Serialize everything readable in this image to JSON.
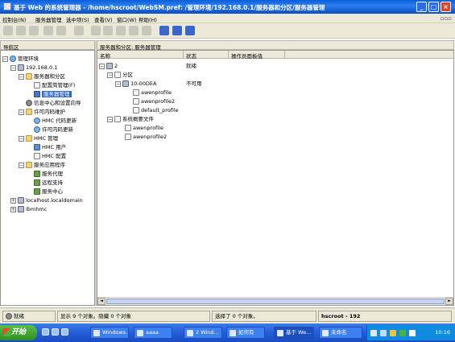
{
  "window": {
    "title": "基于 Web 的系统管理器 - /home/hscroot/WebSM.pref: /管理环境/192.168.0.1/服务器和分区/服务器管理",
    "min": "_",
    "max": "□",
    "close": "×"
  },
  "menubar": {
    "items": [
      "控制台(N)",
      "服务器管理",
      "选中项(S)",
      "查看(V)",
      "窗口(W)",
      "帮助(H)"
    ],
    "right": "▫▫▫"
  },
  "nav": {
    "header": "导航区",
    "tree": [
      {
        "label": "管理环境",
        "icon": "globe-icon"
      },
      {
        "label": "192.168.0.1",
        "icon": "server-icon"
      },
      {
        "label": "服务器和分区",
        "icon": "folder-icon"
      },
      {
        "label": "配置简管理(F)",
        "icon": "page-icon"
      },
      {
        "label": "服务器管理",
        "icon": "page-icon"
      },
      {
        "label": "信息中心和设置向导",
        "icon": "gear-icon"
      },
      {
        "label": "许可内码维护",
        "icon": "folder-icon"
      },
      {
        "label": "HMC 代码更新",
        "icon": "globe-icon"
      },
      {
        "label": "许可内码更新",
        "icon": "globe-icon"
      },
      {
        "label": "HMC 管理",
        "icon": "folder-icon"
      },
      {
        "label": "HMC 用户",
        "icon": "user-icon"
      },
      {
        "label": "HMC 配置",
        "icon": "page-icon"
      },
      {
        "label": "服务应用程序",
        "icon": "folder-icon"
      },
      {
        "label": "服务代理",
        "icon": "tool-icon"
      },
      {
        "label": "远程支持",
        "icon": "tool-icon"
      },
      {
        "label": "服务中心",
        "icon": "tool-icon"
      },
      {
        "label": "localhost.localdomain",
        "icon": "server-icon"
      },
      {
        "label": "ibmhmc",
        "icon": "server-icon"
      }
    ]
  },
  "main": {
    "header": "服务器和分区: 服务器管理",
    "columns": [
      "名称",
      "状态",
      "操作员面板值"
    ],
    "rows": [
      {
        "name": "2",
        "status": "就绪",
        "panel": ""
      },
      {
        "name": "分区",
        "status": "",
        "panel": ""
      },
      {
        "name": "10-00DEA",
        "status": "不可用",
        "panel": ""
      },
      {
        "name": "awenprofile",
        "status": "",
        "panel": ""
      },
      {
        "name": "awenprofile2",
        "status": "",
        "panel": ""
      },
      {
        "name": "default_profile",
        "status": "",
        "panel": ""
      },
      {
        "name": "系统概要文件",
        "status": "",
        "panel": ""
      },
      {
        "name": "awenprofile",
        "status": "",
        "panel": ""
      },
      {
        "name": "awenprofile2",
        "status": "",
        "panel": ""
      }
    ],
    "scroll_left": "◄",
    "scroll_right": "►"
  },
  "status": {
    "ready": "就绪",
    "shown": "显示 9 个对象。隐藏 0 个对象",
    "selected": "选择了 0 个对象。",
    "user": "hscroot - 192"
  },
  "taskbar": {
    "start": "开始",
    "tasks": [
      "Windows...",
      "aaaa",
      "2 Wind...",
      "如何有",
      "基于 We...",
      "未命名"
    ],
    "clock": "10:16"
  },
  "colors": {
    "selection": "#316ac5",
    "titlebar": "#0a5fd8",
    "taskbar": "#245edb"
  }
}
